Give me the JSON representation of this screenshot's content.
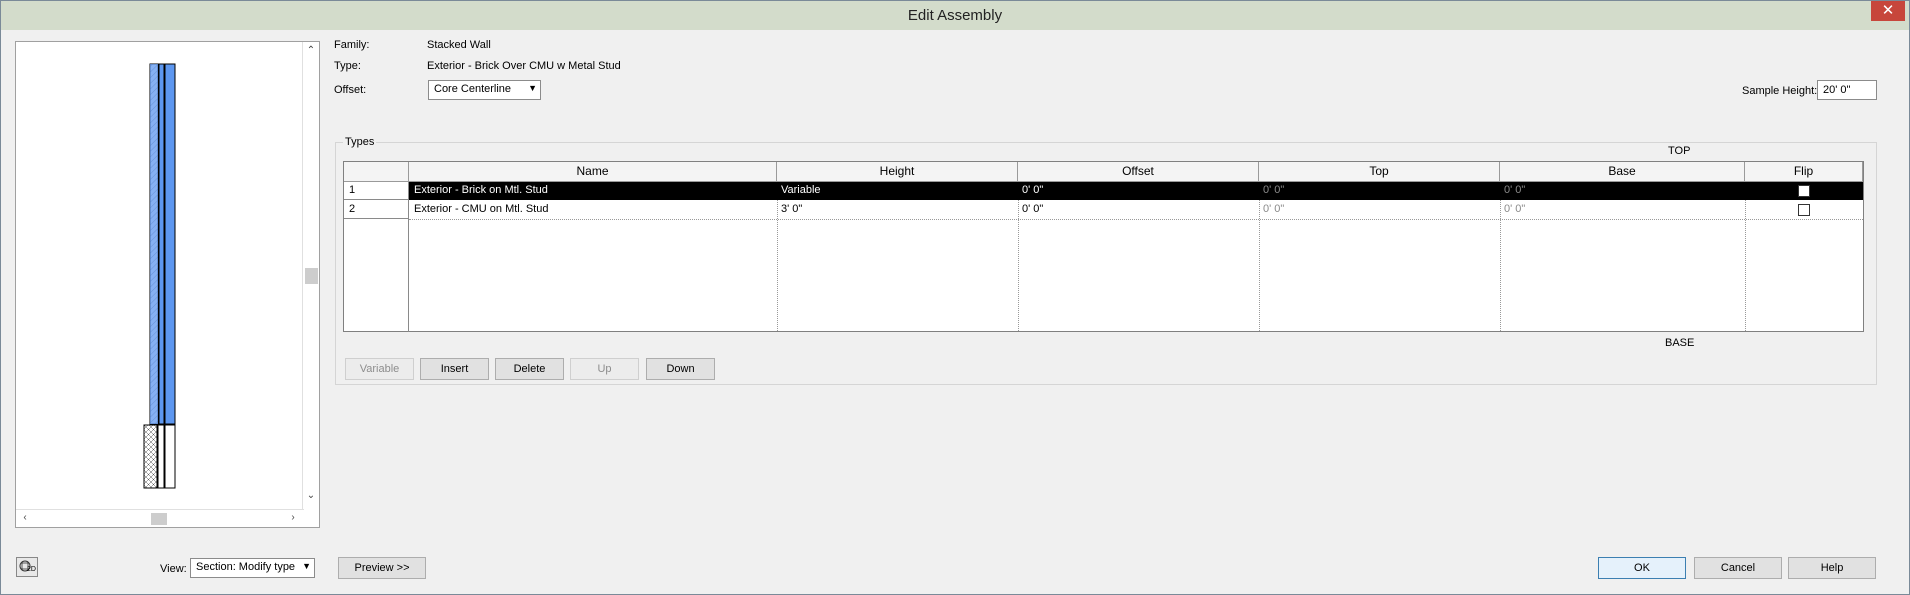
{
  "window": {
    "title": "Edit Assembly",
    "close_glyph": "✕"
  },
  "info": {
    "family_label": "Family:",
    "family_value": "Stacked Wall",
    "type_label": "Type:",
    "type_value": "Exterior - Brick Over CMU w Metal Stud",
    "offset_label": "Offset:",
    "offset_value": "Core Centerline",
    "sample_height_label": "Sample Height:",
    "sample_height_value": "20'  0\""
  },
  "types": {
    "group_label": "Types",
    "top_label": "TOP",
    "base_label": "BASE",
    "columns": [
      "Name",
      "Height",
      "Offset",
      "Top",
      "Base",
      "Flip"
    ],
    "rows": [
      {
        "num": "1",
        "name": "Exterior - Brick on Mtl. Stud",
        "height": "Variable",
        "offset": "0'  0\"",
        "top": "0'  0\"",
        "base": "0'  0\"",
        "flip": false,
        "selected": true
      },
      {
        "num": "2",
        "name": "Exterior - CMU on Mtl. Stud",
        "height": "3'  0\"",
        "offset": "0'  0\"",
        "top": "0'  0\"",
        "base": "0'  0\"",
        "flip": false,
        "selected": false
      }
    ]
  },
  "row_buttons": {
    "variable": "Variable",
    "insert": "Insert",
    "delete": "Delete",
    "up": "Up",
    "down": "Down"
  },
  "bottom": {
    "view_label": "View:",
    "view_value": "Section: Modify type",
    "preview_button": "Preview >>",
    "ok": "OK",
    "cancel": "Cancel",
    "help": "Help",
    "toggle_2d_text": "2D"
  },
  "colors": {
    "wall_fill": "#5d97f0",
    "titlebar": "#d3dccb",
    "selected_row": "#000000"
  }
}
